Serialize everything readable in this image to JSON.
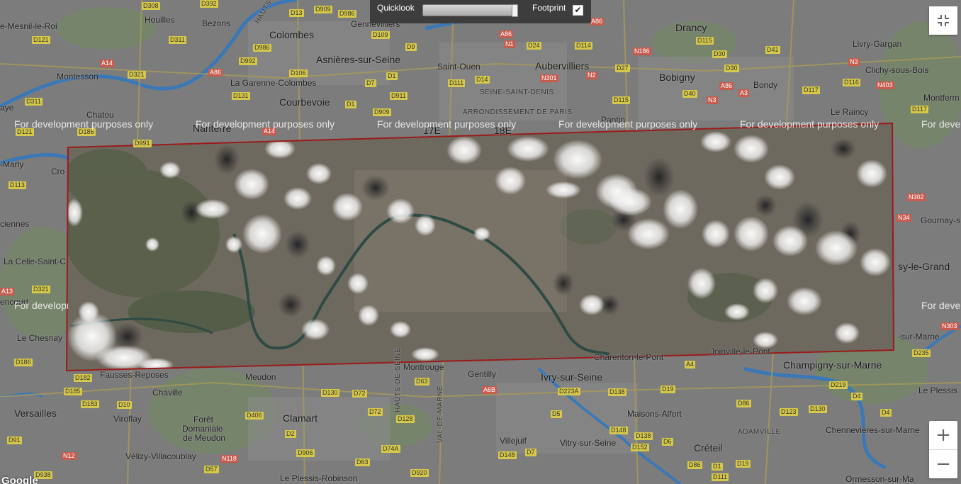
{
  "map": {
    "watermark_text": "For development purposes only",
    "google_logo": "Google",
    "places": {
      "houilles": "Houilles",
      "bezons": "Bezons",
      "gennevilliers": "Gennevilliers",
      "mesnil": "e-Mesnil-le-Roi",
      "colombes": "Colombes",
      "asnieres": "Asnières-sur-Seine",
      "montesson": "Montesson",
      "garenne": "La Garenne-Colombes",
      "courbevoie": "Courbevoie",
      "chatou": "Chatou",
      "nanterre": "Nanterre",
      "saint_ouen": "Saint-Ouen",
      "aubervilliers": "Aubervilliers",
      "drancy": "Drancy",
      "bobigny": "Bobigny",
      "livry": "Livry-Gargan",
      "clichy": "Clichy-sous-Bois",
      "bondy": "Bondy",
      "montferm": "Montferm",
      "raincy": "Le Raincy",
      "pantin": "Pantin",
      "seine_st_denis": "SEINE-SAINT-DENIS",
      "arrondissement": "ARRONDISSEMENT DE PARIS",
      "arr17": "17E",
      "arr18": "18E",
      "aye": "aye",
      "croissy": "Cro",
      "marly": "-Marly",
      "ciennes": "ciennes",
      "celle": "La Celle-Saint-C",
      "encourt": "encourt",
      "chesnay": "Le Chesnay",
      "gournay": "Gournay-s",
      "noisy": "sy-le-Grand",
      "sur_marne": "-sur-Marne",
      "champigny": "Champigny-sur-Marne",
      "plessis": "Le Plessis",
      "fausses": "Fausses-Reposes",
      "meudon": "Meudon",
      "montrouge": "Montrouge",
      "gentilly": "Gentilly",
      "ivry": "Ivry-sur-Seine",
      "charenton": "Charenton-le-Pont",
      "joinville": "Joinville-le-Pont",
      "chaville": "Chaville",
      "versailles": "Versailles",
      "viroflay": "Viroflay",
      "foret": "Forêt",
      "domaniale": "Domaniale",
      "de_meudon": "de Meudon",
      "clamart": "Clamart",
      "maisons": "Maisons-Alfort",
      "chennevieres": "Chennevières-sur-Marne",
      "adamville": "ADAMVILLE",
      "velizy": "Vélizy-Villacoublay",
      "villejuif": "Villejuif",
      "vitry": "Vitry-sur-Seine",
      "creteil": "Créteil",
      "plessis_robinson": "Le Plessis-Robinson",
      "ormesson": "Ormesson-sur-Ma",
      "hauts_de_seine_v": "HAUTS-DE-SEINE",
      "val_de_marne_v": "VAL-DE-MARNE",
      "hauts_de_seine_top": "HAUTS-DE"
    },
    "roads": {
      "r1": "D308",
      "r2": "D392",
      "r3": "D13",
      "r4": "D909",
      "r5": "D986",
      "r6": "D121",
      "r7": "D311",
      "r8": "D986",
      "r9": "D109",
      "r10": "D9",
      "r11": "A86",
      "r12": "N1",
      "r13": "D24",
      "r14": "D114",
      "r15": "A14",
      "r16": "D321",
      "r17": "A86",
      "r18": "D992",
      "r19": "D106",
      "r20": "D1",
      "r21": "D14",
      "r22": "D131",
      "r23": "D7",
      "r24": "D911",
      "r25": "D111",
      "r26": "N301",
      "r27": "N2",
      "r28": "D27",
      "r29": "D311",
      "r30": "D1",
      "r31": "D909",
      "r32": "D115",
      "r33": "D40",
      "r34": "A86",
      "r35": "A3",
      "r36": "N3",
      "r37": "D117",
      "r38": "D116",
      "r39": "N403",
      "r40": "D121",
      "r41": "D186",
      "r42": "A14",
      "r43": "D991",
      "r44": "D113",
      "r45": "D321",
      "r46": "A13",
      "r47": "D186",
      "r48": "D182",
      "r49": "D185",
      "r50": "D183",
      "r51": "D10",
      "r52": "D406",
      "r53": "D130",
      "r54": "D72",
      "r55": "D63",
      "r56": "A6B",
      "r57": "D223A",
      "r58": "D138",
      "r59": "D19",
      "r60": "D86",
      "r61": "D123",
      "r62": "D130",
      "r63": "D4",
      "r64": "D219",
      "r65": "D4",
      "r66": "D235",
      "r67": "N303",
      "r68": "N34",
      "r69": "N302",
      "r70": "D117",
      "r71": "A86",
      "r72": "N186",
      "r73": "D115",
      "r74": "D30",
      "r75": "D41",
      "r76": "N3",
      "r77": "D30",
      "r78": "D2",
      "r79": "D128",
      "r80": "D72",
      "r81": "D5",
      "r82": "D148",
      "r83": "D138",
      "r84": "D6",
      "r85": "D152",
      "r86": "D91",
      "r87": "N12",
      "r88": "D906",
      "r89": "N118",
      "r90": "D74A",
      "r91": "D148",
      "r92": "D7",
      "r93": "D63",
      "r94": "D57",
      "r95": "D920",
      "r96": "D86",
      "r97": "D1",
      "r98": "D19",
      "r99": "D111",
      "r100": "D938",
      "r101": "A4"
    }
  },
  "overlay": {
    "footprint_color": "#9b1b1b"
  },
  "controls": {
    "quicklook_label": "Quicklook",
    "quicklook_opacity": 1.0,
    "footprint_label": "Footprint",
    "footprint_checked": true,
    "footprint_checkmark": "✔",
    "fullscreen_icon": "fullscreen-exit-icon",
    "zoom_in_label": "+",
    "zoom_out_label": "−"
  }
}
